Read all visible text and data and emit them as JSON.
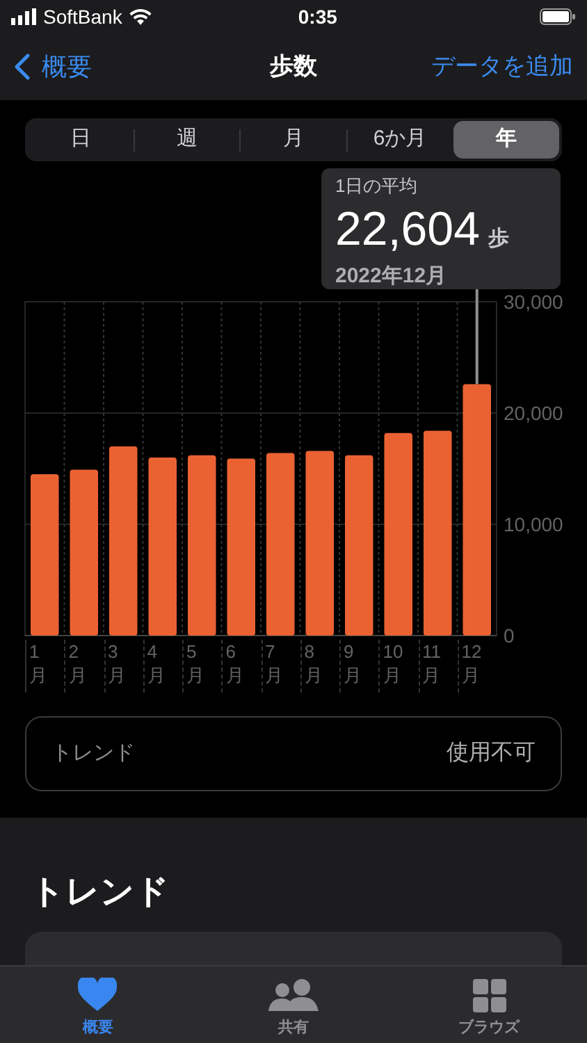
{
  "status_bar": {
    "carrier": "SoftBank",
    "time": "0:35"
  },
  "nav_bar": {
    "back_label": "概要",
    "title": "歩数",
    "action": "データを追加"
  },
  "segments": [
    {
      "label": "日",
      "selected": false
    },
    {
      "label": "週",
      "selected": false
    },
    {
      "label": "月",
      "selected": false
    },
    {
      "label": "6か月",
      "selected": false
    },
    {
      "label": "年",
      "selected": true
    }
  ],
  "callout": {
    "label": "1日の平均",
    "value": "22,604",
    "unit": "歩",
    "period": "2022年12月"
  },
  "chart_data": {
    "type": "bar",
    "categories": [
      "1月",
      "2月",
      "3月",
      "4月",
      "5月",
      "6月",
      "7月",
      "8月",
      "9月",
      "10月",
      "11月",
      "12月"
    ],
    "series": [
      {
        "color": "#eb6232",
        "values": [
          14500,
          14900,
          17000,
          16000,
          16200,
          15900,
          16400,
          16600,
          16200,
          18200,
          18400,
          22600
        ]
      }
    ],
    "ylim": [
      0,
      30000
    ],
    "yticks": [
      {
        "value": 0,
        "label": "0"
      },
      {
        "value": 10000,
        "label": "10,000"
      },
      {
        "value": 20000,
        "label": "20,000"
      },
      {
        "value": 30000,
        "label": "30,000"
      }
    ],
    "annotations": [
      {
        "x": "12月"
      }
    ]
  },
  "trend_row": {
    "label": "トレンド",
    "value": "使用不可"
  },
  "section": {
    "title": "トレンド"
  },
  "tab_bar": [
    {
      "kind": "heart",
      "label": "概要",
      "selected": true
    },
    {
      "kind": "people",
      "label": "共有",
      "selected": false
    },
    {
      "kind": "grid",
      "label": "ブラウズ",
      "selected": false
    }
  ]
}
